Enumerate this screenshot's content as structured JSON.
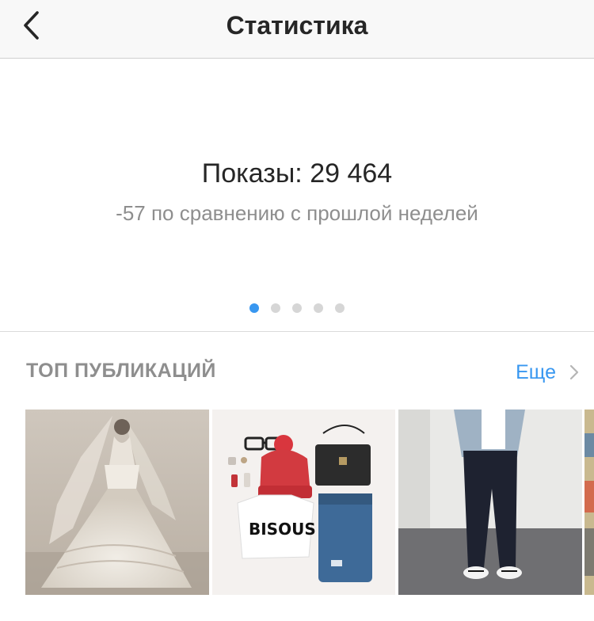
{
  "header": {
    "title": "Статистика",
    "back_icon": "chevron-left-icon"
  },
  "stats": {
    "metric": "Показы: 29 464",
    "comparison": "-57 по сравнению с прошлой неделей",
    "pager": {
      "count": 5,
      "active_index": 0
    }
  },
  "top_posts": {
    "title": "ТОП ПУБЛИКАЦИЙ",
    "more_label": "Еще",
    "more_icon": "chevron-right-icon",
    "thumbnails": [
      {
        "subject": "vintage bride in lace wedding gown"
      },
      {
        "subject": "flat lay: red knit hat, glasses, bag, jeans, BISOUS tee"
      },
      {
        "subject": "person in black trousers and white sneakers"
      },
      {
        "subject": "partial fourth image"
      }
    ]
  },
  "colors": {
    "accent": "#3897f0",
    "text_primary": "#262626",
    "text_secondary": "#8e8e8e",
    "header_bg": "#f8f8f8"
  }
}
